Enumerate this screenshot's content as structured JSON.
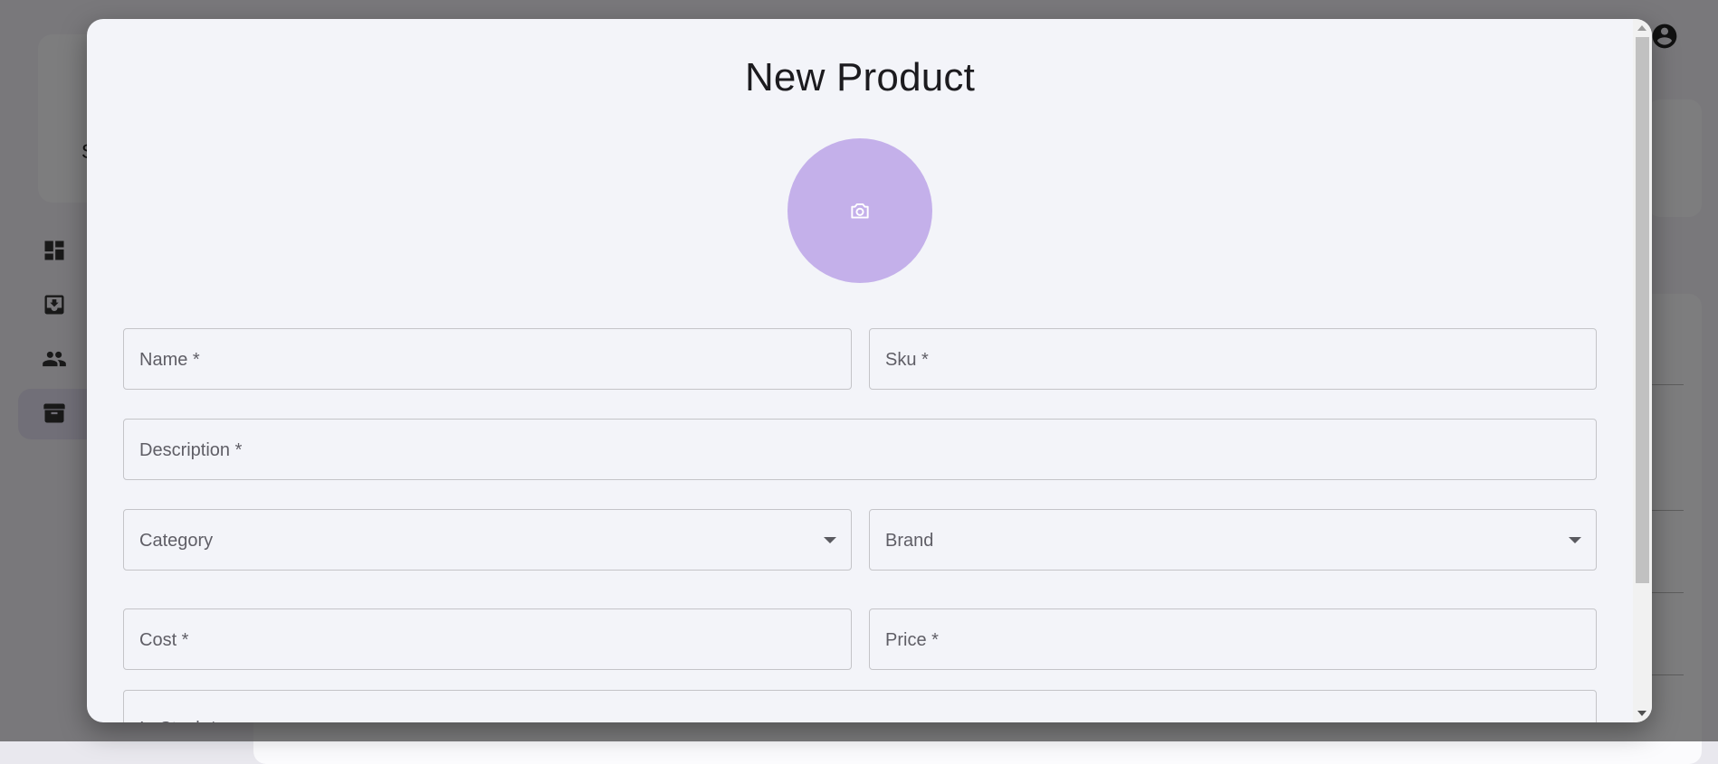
{
  "background": {
    "sidebar_letter": "S",
    "nav_icons": [
      "dashboard-icon",
      "inbox-download-icon",
      "people-icon",
      "archive-icon"
    ],
    "account_icon": "account-circle-icon"
  },
  "dialog": {
    "title": "New Product",
    "photo_icon": "camera-icon",
    "fields": {
      "name": "Name *",
      "sku": "Sku *",
      "description": "Description *",
      "category": "Category",
      "brand": "Brand",
      "cost": "Cost *",
      "price": "Price *",
      "in_stock": "In Stock *"
    }
  },
  "colors": {
    "accent": "#c4b0ea",
    "dialog_bg": "#f3f4f9",
    "text": "#1c1b1f"
  }
}
